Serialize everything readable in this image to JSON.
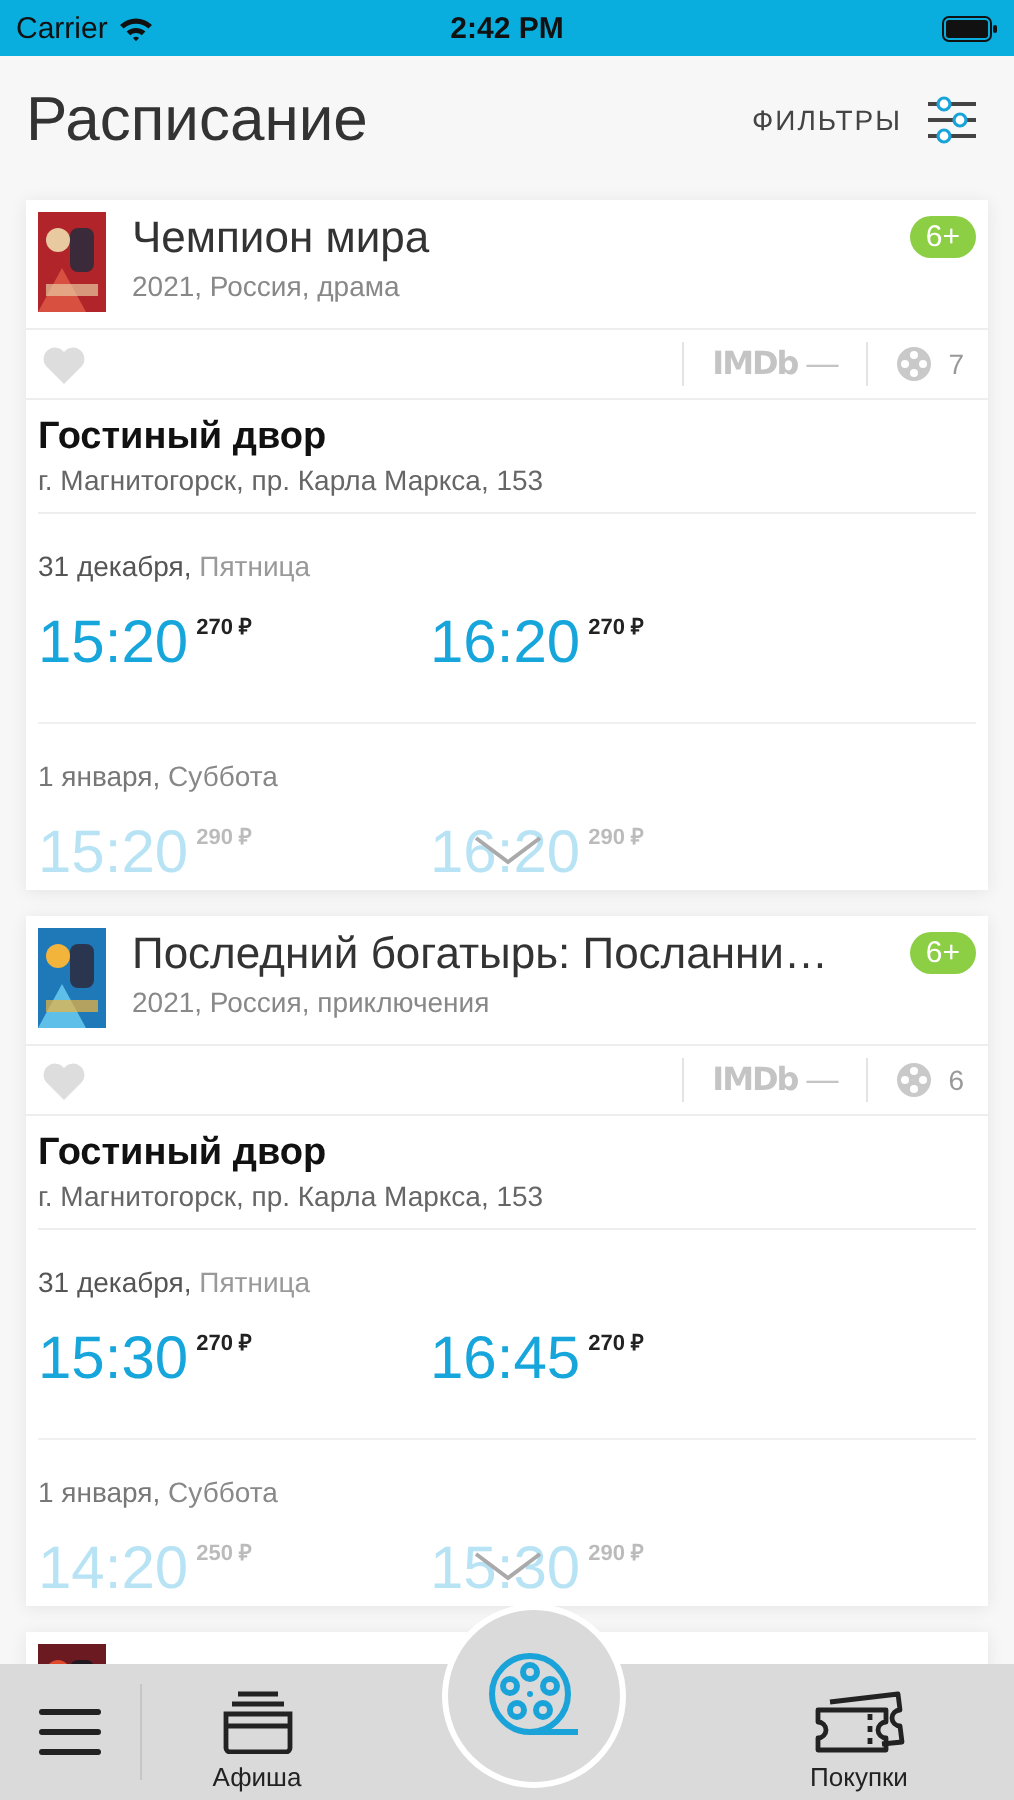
{
  "status_bar": {
    "carrier": "Carrier",
    "time": "2:42 PM"
  },
  "header": {
    "title": "Расписание",
    "filters_label": "ФИЛЬТРЫ"
  },
  "movies": [
    {
      "title": "Чемпион мира",
      "meta": "2021, Россия, драма",
      "age": "6+",
      "favorite": false,
      "imdb_label": "IMDb",
      "rating": "—",
      "cinemas_count": "7",
      "cinema": {
        "name": "Гостиный двор",
        "address": "г. Магнитогорск, пр. Карла Маркса, 153"
      },
      "days": [
        {
          "date": "31 декабря,",
          "weekday": "Пятница",
          "faded": false,
          "sessions": [
            {
              "time": "15:20",
              "price": "270 ₽"
            },
            {
              "time": "16:20",
              "price": "270 ₽"
            }
          ]
        },
        {
          "date": "1 января,",
          "weekday": "Суббота",
          "faded": true,
          "sessions": [
            {
              "time": "15:20",
              "price": "290 ₽"
            },
            {
              "time": "16:20",
              "price": "290 ₽"
            }
          ]
        }
      ]
    },
    {
      "title": "Последний богатырь: Посланни…",
      "meta": "2021, Россия, приключения",
      "age": "6+",
      "favorite": false,
      "imdb_label": "IMDb",
      "rating": "—",
      "cinemas_count": "6",
      "cinema": {
        "name": "Гостиный двор",
        "address": "г. Магнитогорск, пр. Карла Маркса, 153"
      },
      "days": [
        {
          "date": "31 декабря,",
          "weekday": "Пятница",
          "faded": false,
          "sessions": [
            {
              "time": "15:30",
              "price": "270 ₽"
            },
            {
              "time": "16:45",
              "price": "270 ₽"
            }
          ]
        },
        {
          "date": "1 января,",
          "weekday": "Суббота",
          "faded": true,
          "sessions": [
            {
              "time": "14:20",
              "price": "250 ₽"
            },
            {
              "time": "15:30",
              "price": "290 ₽"
            }
          ]
        }
      ]
    },
    {
      "kind": "covered"
    }
  ],
  "tab_bar": [
    {
      "kind": "menu",
      "selected": false
    },
    {
      "kind": "posters",
      "label": "Афиша",
      "selected": false
    },
    {
      "kind": "reel",
      "selected": true
    },
    {
      "kind": "tickets",
      "label": "Покупки",
      "selected": false
    }
  ]
}
